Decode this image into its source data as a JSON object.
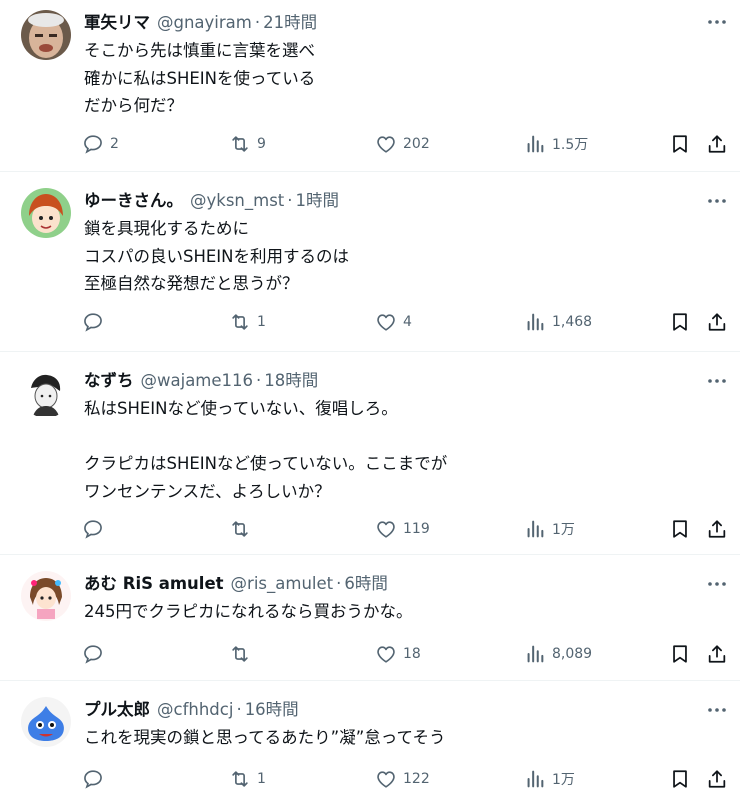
{
  "icons": {
    "reply": "reply-icon",
    "retweet": "retweet-icon",
    "like": "heart-icon",
    "views": "views-icon",
    "bookmark": "bookmark-icon",
    "share": "share-icon",
    "more": "more-icon"
  },
  "posts": [
    {
      "name": "軍矢リマ",
      "handle": "@gnayiram",
      "sep": "·",
      "time": "21時間",
      "text": "そこから先は慎重に言葉を選べ\n確かに私はSHEINを使っている\nだから何だ？",
      "replies": "2",
      "retweets": "9",
      "likes": "202",
      "views": "1.5万"
    },
    {
      "name": "ゆーきさん。",
      "handle": "@yksn_mst",
      "sep": "·",
      "time": "1時間",
      "text": "鎖を具現化するために\nコスパの良いSHEINを利用するのは\n至極自然な発想だと思うが？",
      "replies": "",
      "retweets": "1",
      "likes": "4",
      "views": "1,468"
    },
    {
      "name": "なずち",
      "handle": "@wajame116",
      "sep": "·",
      "time": "18時間",
      "text": "私はSHEINなど使っていない、復唱しろ。\n\nクラピカはSHEINなど使っていない。ここまでが\nワンセンテンスだ、よろしいか？",
      "replies": "",
      "retweets": "",
      "likes": "119",
      "views": "1万"
    },
    {
      "name": "あむ RiS amulet",
      "handle": "@ris_amulet",
      "sep": "·",
      "time": "6時間",
      "text": "245円でクラピカになれるなら買おうかな。",
      "replies": "",
      "retweets": "",
      "likes": "18",
      "views": "8,089"
    },
    {
      "name": "プル太郎",
      "handle": "@cfhhdcj",
      "sep": "·",
      "time": "16時間",
      "text": "これを現実の鎖と思ってるあたり”凝”怠ってそう",
      "replies": "",
      "retweets": "1",
      "likes": "122",
      "views": "1万"
    }
  ]
}
